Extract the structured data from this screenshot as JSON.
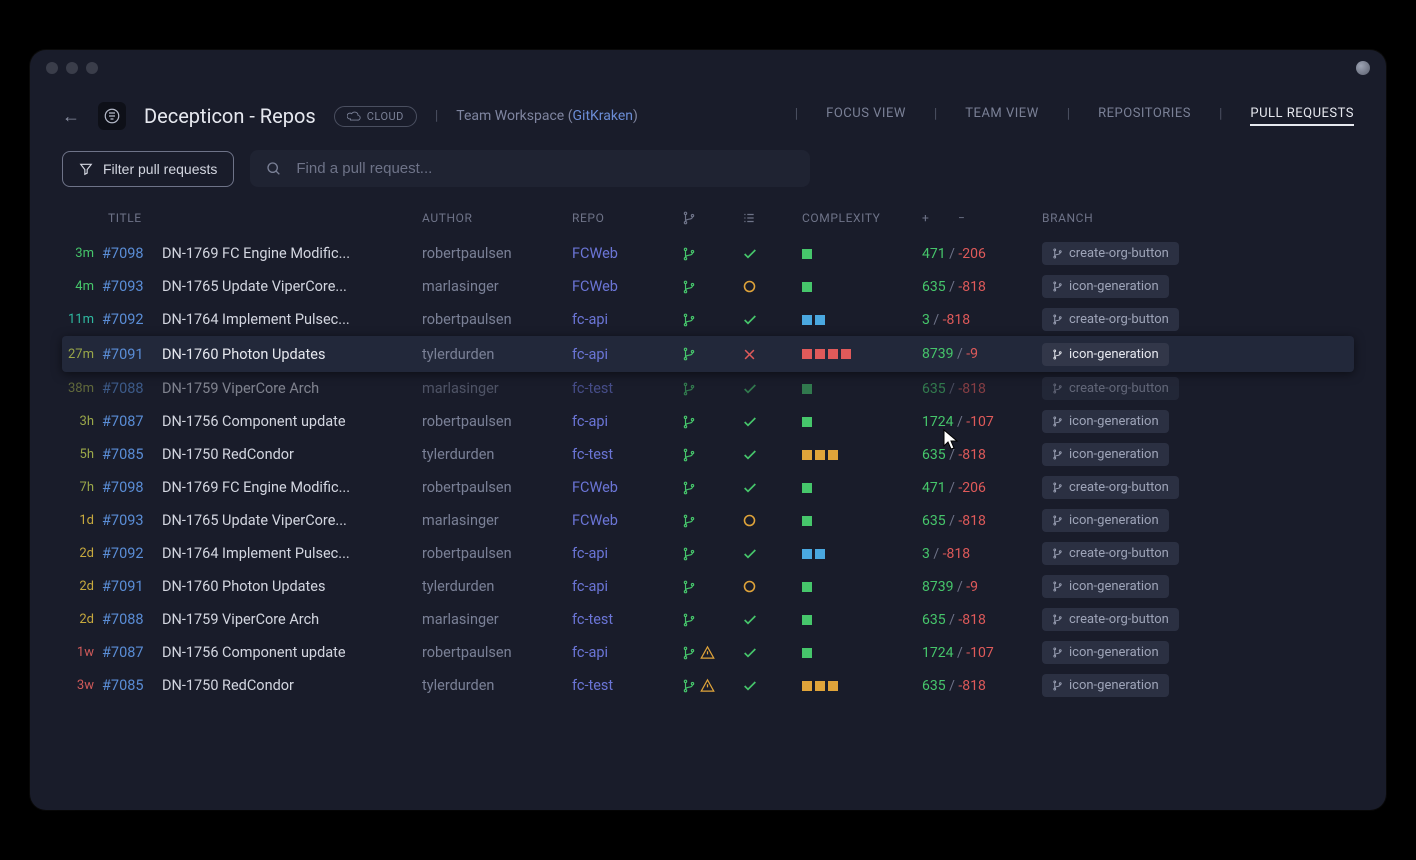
{
  "workspace": {
    "title": "Decepticon - Repos",
    "cloud_label": "CLOUD",
    "team_label_prefix": "Team Workspace (",
    "team_label_accent": "GitKraken",
    "team_label_suffix": ")"
  },
  "nav": {
    "focus": "FOCUS VIEW",
    "team": "TEAM VIEW",
    "repos": "REPOSITORIES",
    "prs": "PULL REQUESTS"
  },
  "controls": {
    "filter_label": "Filter pull requests",
    "search_placeholder": "Find a pull request..."
  },
  "columns": {
    "title": "TITLE",
    "author": "AUTHOR",
    "repo": "REPO",
    "complexity": "COMPLEXITY",
    "plus": "+",
    "minus": "−",
    "branch": "BRANCH"
  },
  "rows": [
    {
      "age": "3m",
      "age_c": "green",
      "num": "#7098",
      "title": "DN-1769 FC Engine Modific...",
      "author": "robertpaulsen",
      "repo": "FCWeb",
      "status": "check",
      "cx": [
        [
          "green"
        ]
      ],
      "add": "471",
      "del": "-206",
      "branch": "create-org-button"
    },
    {
      "age": "4m",
      "age_c": "green",
      "num": "#7093",
      "title": "DN-1765 Update ViperCore...",
      "author": "marlasinger",
      "repo": "FCWeb",
      "status": "pending",
      "cx": [
        [
          "green"
        ]
      ],
      "add": "635",
      "del": "-818",
      "branch": "icon-generation"
    },
    {
      "age": "11m",
      "age_c": "teal",
      "num": "#7092",
      "title": "DN-1764 Implement Pulsec...",
      "author": "robertpaulsen",
      "repo": "fc-api",
      "status": "check",
      "cx": [
        [
          "blue"
        ],
        [
          "blue"
        ]
      ],
      "add": "3",
      "del": "-818",
      "branch": "create-org-button"
    },
    {
      "age": "27m",
      "age_c": "olive",
      "num": "#7091",
      "title": "DN-1760 Photon Updates",
      "author": "tylerdurden",
      "repo": "fc-api",
      "status": "fail",
      "cx": [
        [
          "red"
        ],
        [
          "red"
        ],
        [
          "red"
        ],
        [
          "red"
        ]
      ],
      "add": "8739",
      "del": "-9",
      "branch": "icon-generation",
      "hl": true
    },
    {
      "age": "38m",
      "age_c": "olive",
      "num": "#7088",
      "title": "DN-1759 ViperCore Arch",
      "author": "marlasinger",
      "repo": "fc-test",
      "status": "check",
      "cx": [
        [
          "green"
        ]
      ],
      "add": "635",
      "del": "-818",
      "branch": "create-org-button",
      "dim": true
    },
    {
      "age": "3h",
      "age_c": "olive",
      "num": "#7087",
      "title": "DN-1756 Component update",
      "author": "robertpaulsen",
      "repo": "fc-api",
      "status": "check",
      "cx": [
        [
          "green"
        ]
      ],
      "add": "1724",
      "del": "-107",
      "branch": "icon-generation"
    },
    {
      "age": "5h",
      "age_c": "olive",
      "num": "#7085",
      "title": "DN-1750 RedCondor",
      "author": "tylerdurden",
      "repo": "fc-test",
      "status": "check",
      "cx": [
        [
          "orange"
        ],
        [
          "orange"
        ],
        [
          "orange"
        ]
      ],
      "add": "635",
      "del": "-818",
      "branch": "icon-generation"
    },
    {
      "age": "7h",
      "age_c": "olive",
      "num": "#7098",
      "title": "DN-1769 FC Engine Modific...",
      "author": "robertpaulsen",
      "repo": "FCWeb",
      "status": "check",
      "cx": [
        [
          "green"
        ]
      ],
      "add": "471",
      "del": "-206",
      "branch": "create-org-button"
    },
    {
      "age": "1d",
      "age_c": "yellow",
      "num": "#7093",
      "title": "DN-1765 Update ViperCore...",
      "author": "marlasinger",
      "repo": "FCWeb",
      "status": "pending",
      "cx": [
        [
          "green"
        ]
      ],
      "add": "635",
      "del": "-818",
      "branch": "icon-generation"
    },
    {
      "age": "2d",
      "age_c": "yellow",
      "num": "#7092",
      "title": "DN-1764 Implement Pulsec...",
      "author": "robertpaulsen",
      "repo": "fc-api",
      "status": "check",
      "cx": [
        [
          "blue"
        ],
        [
          "blue"
        ]
      ],
      "add": "3",
      "del": "-818",
      "branch": "create-org-button"
    },
    {
      "age": "2d",
      "age_c": "yellow",
      "num": "#7091",
      "title": "DN-1760 Photon Updates",
      "author": "tylerdurden",
      "repo": "fc-api",
      "status": "pending",
      "cx": [
        [
          "green"
        ]
      ],
      "add": "8739",
      "del": "-9",
      "branch": "icon-generation"
    },
    {
      "age": "2d",
      "age_c": "yellow",
      "num": "#7088",
      "title": "DN-1759 ViperCore Arch",
      "author": "marlasinger",
      "repo": "fc-test",
      "status": "check",
      "cx": [
        [
          "green"
        ]
      ],
      "add": "635",
      "del": "-818",
      "branch": "create-org-button"
    },
    {
      "age": "1w",
      "age_c": "red",
      "num": "#7087",
      "title": "DN-1756 Component update",
      "author": "robertpaulsen",
      "repo": "fc-api",
      "status": "check",
      "cx": [
        [
          "green"
        ]
      ],
      "add": "1724",
      "del": "-107",
      "branch": "icon-generation",
      "warn": true
    },
    {
      "age": "3w",
      "age_c": "red",
      "num": "#7085",
      "title": "DN-1750 RedCondor",
      "author": "tylerdurden",
      "repo": "fc-test",
      "status": "check",
      "cx": [
        [
          "orange"
        ],
        [
          "orange"
        ],
        [
          "orange"
        ]
      ],
      "add": "635",
      "del": "-818",
      "branch": "icon-generation",
      "warn": true
    }
  ]
}
